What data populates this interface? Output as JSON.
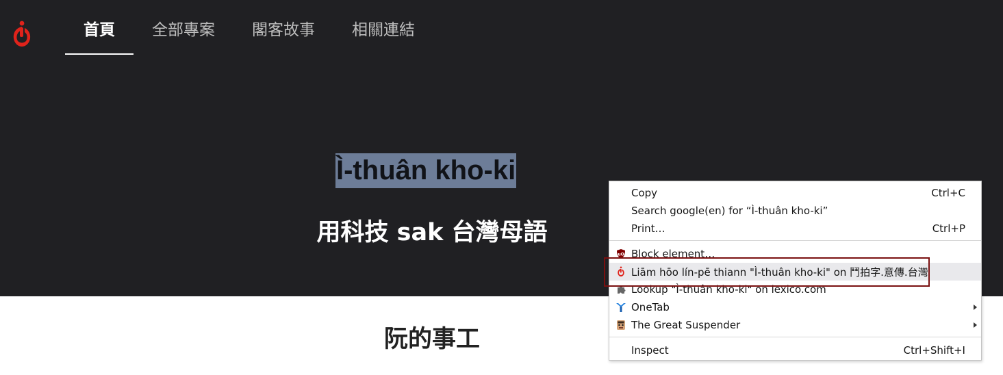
{
  "nav": {
    "items": [
      {
        "label": "首頁",
        "active": true
      },
      {
        "label": "全部專案",
        "active": false
      },
      {
        "label": "閣客故事",
        "active": false
      },
      {
        "label": "相關連結",
        "active": false
      }
    ]
  },
  "hero": {
    "title": "Ì-thuân kho-ki",
    "subtitle": "用科技 sak 台灣母語"
  },
  "section": {
    "title": "阮的事工"
  },
  "context_menu": {
    "copy": {
      "label": "Copy",
      "shortcut": "Ctrl+C"
    },
    "search": {
      "label": "Search google(en) for “Ì-thuân kho-ki”"
    },
    "print": {
      "label": "Print…",
      "shortcut": "Ctrl+P"
    },
    "block": {
      "label": "Block element…",
      "icon": "ublock-shield-icon"
    },
    "liam": {
      "label": "Liām hōo lín-pē thiann \"Ì-thuân kho-ki\" on 鬥拍字.意傳.台灣",
      "icon": "ithuan-logo-icon"
    },
    "lookup": {
      "label": "Lookup \"Ì-thuân kho-ki\" on lexico.com",
      "icon": "puzzle-piece-icon"
    },
    "onetab": {
      "label": "OneTab",
      "icon": "onetab-icon"
    },
    "suspender": {
      "label": "The Great Suspender",
      "icon": "great-suspender-icon"
    },
    "inspect": {
      "label": "Inspect",
      "shortcut": "Ctrl+Shift+I"
    }
  },
  "colors": {
    "hero_bg": "#202023",
    "selection": "#6d7d98",
    "brand_red": "#e0231b",
    "highlight_border": "#7a1010"
  }
}
